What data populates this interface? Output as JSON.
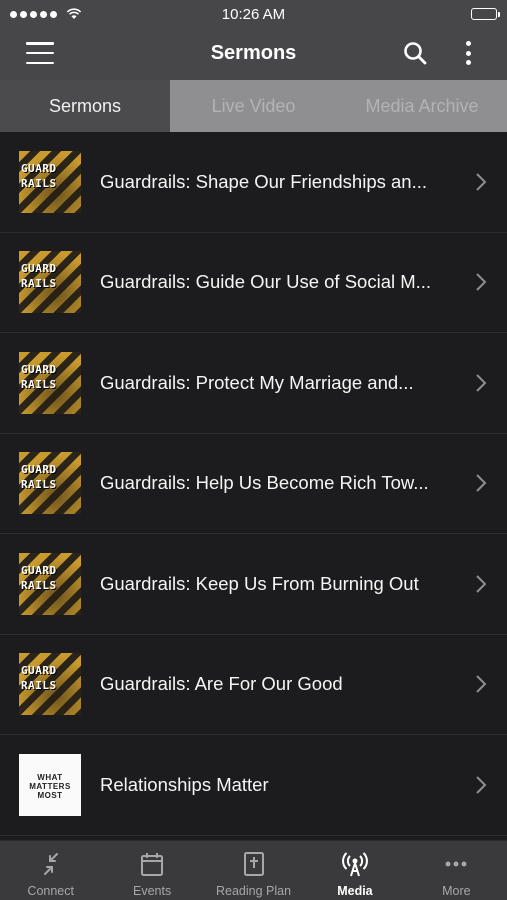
{
  "status_bar": {
    "time": "10:26 AM"
  },
  "nav": {
    "title": "Sermons"
  },
  "tabs": [
    {
      "label": "Sermons",
      "active": true
    },
    {
      "label": "Live Video",
      "active": false
    },
    {
      "label": "Media Archive",
      "active": false
    }
  ],
  "sermons": [
    {
      "title": "Guardrails: Shape Our Friendships an...",
      "thumbnail": "guardrails",
      "thumb_text": "GUARD RAILS"
    },
    {
      "title": "Guardrails: Guide Our Use of Social M...",
      "thumbnail": "guardrails",
      "thumb_text": "GUARD RAILS"
    },
    {
      "title": "Guardrails: Protect My Marriage and...",
      "thumbnail": "guardrails",
      "thumb_text": "GUARD RAILS"
    },
    {
      "title": "Guardrails: Help Us Become Rich Tow...",
      "thumbnail": "guardrails",
      "thumb_text": "GUARD RAILS"
    },
    {
      "title": "Guardrails: Keep Us From Burning Out",
      "thumbnail": "guardrails",
      "thumb_text": "GUARD RAILS"
    },
    {
      "title": "Guardrails: Are For Our Good",
      "thumbnail": "guardrails",
      "thumb_text": "GUARD RAILS"
    },
    {
      "title": "Relationships Matter",
      "thumbnail": "what-matters-most",
      "thumb_text": "WHAT MATTERS MOST"
    }
  ],
  "tab_bar": [
    {
      "label": "Connect",
      "icon": "connect-icon",
      "active": false
    },
    {
      "label": "Events",
      "icon": "calendar-icon",
      "active": false
    },
    {
      "label": "Reading Plan",
      "icon": "bible-icon",
      "active": false
    },
    {
      "label": "Media",
      "icon": "broadcast-icon",
      "active": true
    },
    {
      "label": "More",
      "icon": "ellipsis-icon",
      "active": false
    }
  ],
  "colors": {
    "nav_bg": "#474749",
    "list_bg": "#1c1c1e",
    "tab_active_bg": "#4b4b4d",
    "tab_inactive_bg": "#8f8f91",
    "accent_gold": "#c99a2e"
  }
}
